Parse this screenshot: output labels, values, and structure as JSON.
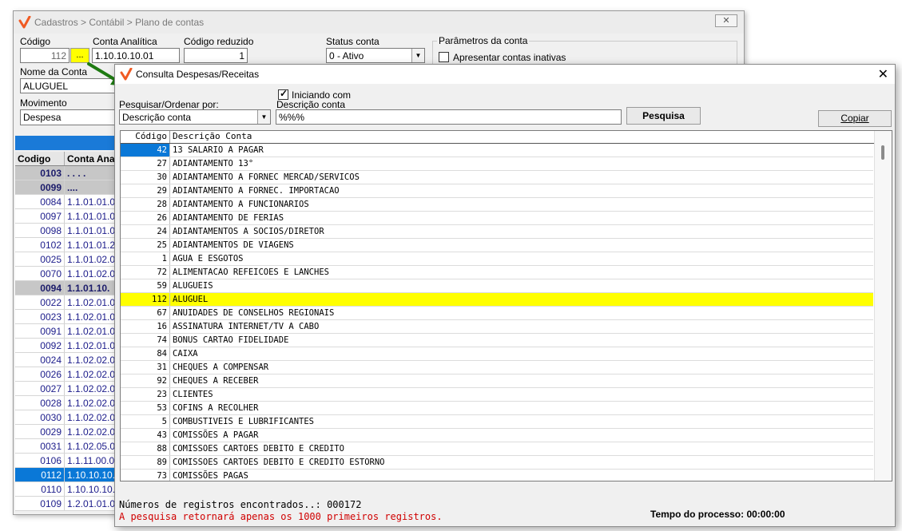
{
  "back_window": {
    "title": "Cadastros > Contábil > Plano de contas",
    "close_label": "✕",
    "codigo_label": "Código",
    "codigo_value": "112",
    "ellipsis_label": "...",
    "conta_analitica_label": "Conta Analítica",
    "conta_analitica_value": "1.10.10.10.01",
    "codigo_reduzido_label": "Código reduzido",
    "codigo_reduzido_value": "1",
    "status_label": "Status conta",
    "status_value": "0 - Ativo",
    "parametros_label": "Parâmetros da conta",
    "inativas_label": "Apresentar contas inativas",
    "nome_label": "Nome da Conta",
    "nome_value": "ALUGUEL",
    "movimento_label": "Movimento",
    "movimento_value": "Despesa",
    "grid_headers": [
      "Codigo",
      "Conta Anal"
    ],
    "rows": [
      {
        "code": "0103",
        "account": ". . . .",
        "style": "gray"
      },
      {
        "code": "0099",
        "account": "....",
        "style": "gray"
      },
      {
        "code": "0084",
        "account": "1.1.01.01.0",
        "style": ""
      },
      {
        "code": "0097",
        "account": "1.1.01.01.0",
        "style": ""
      },
      {
        "code": "0098",
        "account": "1.1.01.01.0",
        "style": ""
      },
      {
        "code": "0102",
        "account": "1.1.01.01.2",
        "style": ""
      },
      {
        "code": "0025",
        "account": "1.1.01.02.0",
        "style": ""
      },
      {
        "code": "0070",
        "account": "1.1.01.02.0",
        "style": ""
      },
      {
        "code": "0094",
        "account": "1.1.01.10.",
        "style": "gray"
      },
      {
        "code": "0022",
        "account": "1.1.02.01.0",
        "style": ""
      },
      {
        "code": "0023",
        "account": "1.1.02.01.0",
        "style": ""
      },
      {
        "code": "0091",
        "account": "1.1.02.01.0",
        "style": ""
      },
      {
        "code": "0092",
        "account": "1.1.02.01.0",
        "style": ""
      },
      {
        "code": "0024",
        "account": "1.1.02.02.0",
        "style": ""
      },
      {
        "code": "0026",
        "account": "1.1.02.02.0",
        "style": ""
      },
      {
        "code": "0027",
        "account": "1.1.02.02.0",
        "style": ""
      },
      {
        "code": "0028",
        "account": "1.1.02.02.0",
        "style": ""
      },
      {
        "code": "0030",
        "account": "1.1.02.02.0",
        "style": ""
      },
      {
        "code": "0029",
        "account": "1.1.02.02.0",
        "style": ""
      },
      {
        "code": "0031",
        "account": "1.1.02.05.0",
        "style": ""
      },
      {
        "code": "0106",
        "account": "1.1.11.00.0",
        "style": ""
      },
      {
        "code": "0112",
        "account": "1.10.10.10.",
        "style": "sel"
      },
      {
        "code": "0110",
        "account": "1.10.10.10.",
        "style": ""
      },
      {
        "code": "0109",
        "account": "1.2.01.01.0",
        "style": ""
      }
    ]
  },
  "dialog": {
    "title": "Consulta Despesas/Receitas",
    "close_label": "✕",
    "iniciando_label": "Iniciando com",
    "iniciando_checked": true,
    "pesquisar_label": "Pesquisar/Ordenar por:",
    "pesquisar_value": "Descrição conta",
    "descricao_label": "Descrição conta",
    "descricao_value": "%%%",
    "pesquisa_button": "Pesquisa",
    "copiar_button": "Copiar",
    "grid_headers": [
      "Código",
      "Descrição Conta"
    ],
    "rows": [
      {
        "code": "42",
        "desc": "13 SALARIO A PAGAR"
      },
      {
        "code": "27",
        "desc": "ADIANTAMENTO 13°"
      },
      {
        "code": "30",
        "desc": "ADIANTAMENTO A FORNEC MERCAD/SERVICOS"
      },
      {
        "code": "29",
        "desc": "ADIANTAMENTO A FORNEC. IMPORTACAO"
      },
      {
        "code": "28",
        "desc": "ADIANTAMENTO A FUNCIONARIOS"
      },
      {
        "code": "26",
        "desc": "ADIANTAMENTO DE FERIAS"
      },
      {
        "code": "24",
        "desc": "ADIANTAMENTOS A SOCIOS/DIRETOR"
      },
      {
        "code": "25",
        "desc": "ADIANTAMENTOS DE VIAGENS"
      },
      {
        "code": "1",
        "desc": "AGUA E ESGOTOS"
      },
      {
        "code": "72",
        "desc": "ALIMENTACAO REFEICOES E LANCHES"
      },
      {
        "code": "59",
        "desc": "ALUGUEIS"
      },
      {
        "code": "112",
        "desc": "ALUGUEL"
      },
      {
        "code": "67",
        "desc": "ANUIDADES DE CONSELHOS REGIONAIS"
      },
      {
        "code": "16",
        "desc": "ASSINATURA INTERNET/TV A CABO"
      },
      {
        "code": "74",
        "desc": "BONUS CARTAO FIDELIDADE"
      },
      {
        "code": "84",
        "desc": "CAIXA"
      },
      {
        "code": "31",
        "desc": "CHEQUES A COMPENSAR"
      },
      {
        "code": "92",
        "desc": "CHEQUES A RECEBER"
      },
      {
        "code": "23",
        "desc": "CLIENTES"
      },
      {
        "code": "53",
        "desc": "COFINS A RECOLHER"
      },
      {
        "code": "5",
        "desc": "COMBUSTIVEIS E LUBRIFICANTES"
      },
      {
        "code": "43",
        "desc": "COMISSÕES A PAGAR"
      },
      {
        "code": "88",
        "desc": "COMISSOES CARTOES DEBITO E CREDITO"
      },
      {
        "code": "89",
        "desc": "COMISSOES CARTOES DEBITO E CREDITO ESTORNO"
      },
      {
        "code": "73",
        "desc": "COMISSÕES PAGAS"
      }
    ],
    "highlighted_code": "112",
    "count_text": "Números de registros encontrados..: 000172",
    "warning_text": "A pesquisa retornará apenas os 1000 primeiros registros.",
    "time_text": "Tempo do processo: 00:00:00"
  },
  "colors": {
    "selection_blue": "#0a78d7",
    "highlight_yellow": "#ffff00",
    "warning_red": "#d00000",
    "arrow_green": "#1e7a12",
    "logo_orange": "#f05a22"
  },
  "icons": [
    "app-logo-icon",
    "close-icon",
    "checkbox-icon",
    "dropdown-arrow-icon",
    "pointer-arrow-icon"
  ]
}
